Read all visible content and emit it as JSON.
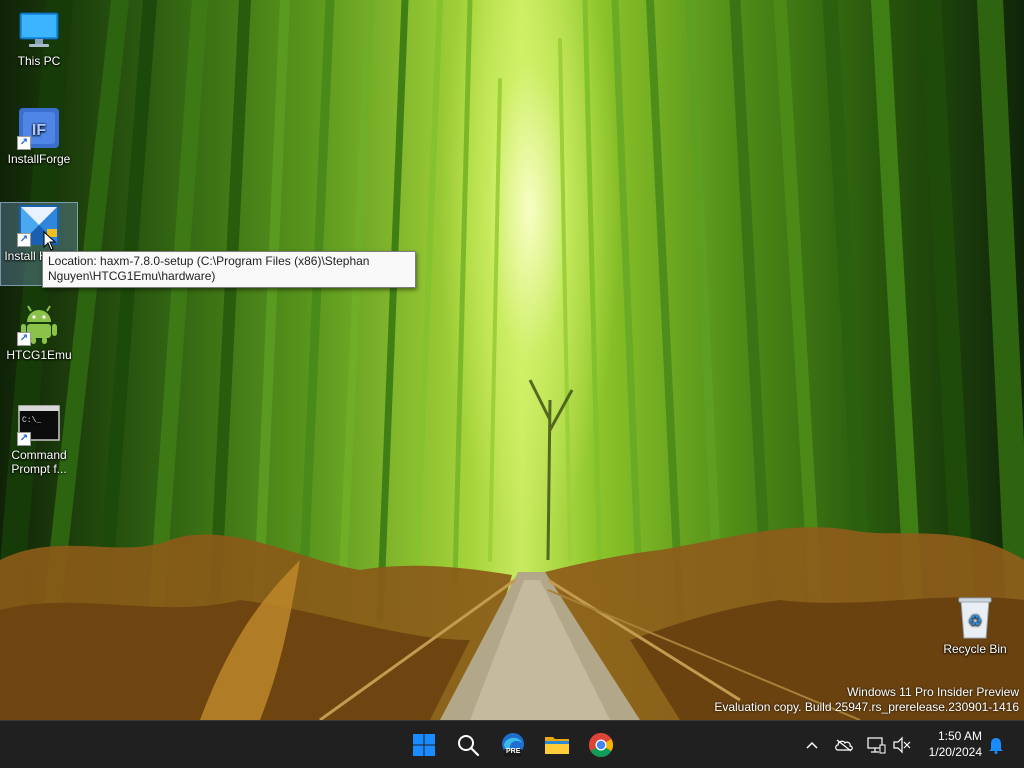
{
  "desktop": {
    "icons": [
      {
        "label": "This PC",
        "icon": "monitor-icon"
      },
      {
        "label": "InstallForge",
        "icon": "installforge-icon"
      },
      {
        "label": "Install HAXM",
        "icon": "haxm-installer-icon"
      },
      {
        "label": "HTCG1Emu",
        "icon": "android-icon"
      },
      {
        "label": "Command Prompt f...",
        "icon": "command-prompt-icon"
      },
      {
        "label": "Recycle Bin",
        "icon": "recycle-bin-icon"
      }
    ],
    "tooltip": "Location: haxm-7.8.0-setup (C:\\Program Files (x86)\\Stephan Nguyen\\HTCG1Emu\\hardware)",
    "watermark": {
      "line1": "Windows 11 Pro Insider Preview",
      "line2": "Evaluation copy. Build 25947.rs_prerelease.230901-1416"
    }
  },
  "taskbar": {
    "pinned": [
      "start-icon",
      "search-icon",
      "edge-beta-icon",
      "file-explorer-icon",
      "chrome-icon"
    ],
    "edge_badge": "PRE",
    "tray": [
      "chevron-up-icon",
      "onedrive-icon",
      "network-icon",
      "volume-muted-icon",
      "notification-bell-icon"
    ],
    "clock": {
      "time": "1:50 AM",
      "date": "1/20/2024"
    }
  },
  "colors": {
    "taskbar": "#202020",
    "accent": "#1a8cff",
    "tooltip_bg": "#f9f9f9"
  }
}
